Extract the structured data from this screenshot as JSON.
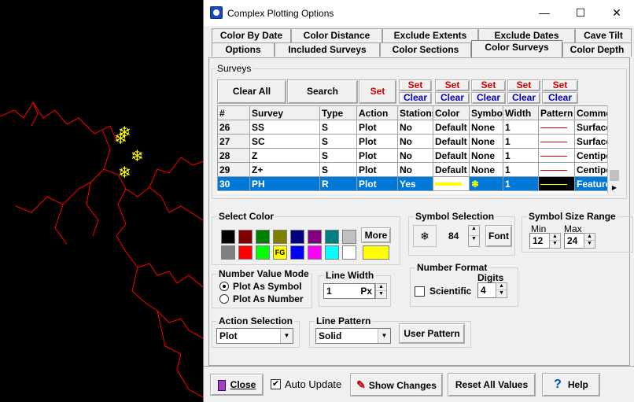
{
  "window": {
    "title": "Complex Plotting Options",
    "minimize": "—",
    "maximize": "☐",
    "close": "✕"
  },
  "tabs_row1": [
    "Color By Date",
    "Color Distance",
    "Exclude Extents",
    "Exclude Dates",
    "Cave Tilt"
  ],
  "tabs_row2": [
    "Options",
    "Included Surveys",
    "Color Sections",
    "Color Surveys",
    "Color Depth"
  ],
  "surveys": {
    "label": "Surveys",
    "clear_all": "Clear All",
    "search": "Search",
    "set": "Set",
    "set_label": "Set",
    "clear_label": "Clear",
    "columns": [
      "#",
      "Survey",
      "Type",
      "Action",
      "Stations",
      "Color",
      "Symbol",
      "Width",
      "Pattern",
      "Comment"
    ],
    "rows": [
      {
        "num": "26",
        "survey": "SS",
        "type": "S",
        "action": "Plot",
        "stations": "No",
        "color": "Default",
        "symbol": "None",
        "width": "1",
        "comment": "Surface"
      },
      {
        "num": "27",
        "survey": "SC",
        "type": "S",
        "action": "Plot",
        "stations": "No",
        "color": "Default",
        "symbol": "None",
        "width": "1",
        "comment": "Surface"
      },
      {
        "num": "28",
        "survey": "Z",
        "type": "S",
        "action": "Plot",
        "stations": "No",
        "color": "Default",
        "symbol": "None",
        "width": "1",
        "comment": "Centipede"
      },
      {
        "num": "29",
        "survey": "Z+",
        "type": "S",
        "action": "Plot",
        "stations": "No",
        "color": "Default",
        "symbol": "None",
        "width": "1",
        "comment": "Centipede"
      },
      {
        "num": "30",
        "survey": "PH",
        "type": "R",
        "action": "Plot",
        "stations": "Yes",
        "color": "",
        "symbol": "❄",
        "width": "1",
        "comment": "Feature"
      }
    ]
  },
  "select_color": {
    "label": "Select Color",
    "more": "More",
    "fg": "FG",
    "colors": [
      "#000000",
      "#800000",
      "#008000",
      "#808000",
      "#000080",
      "#800080",
      "#008080",
      "#c0c0c0",
      "#808080",
      "#ff0000",
      "#00ff00",
      "#ffff00",
      "#0000ff",
      "#ff00ff",
      "#00ffff",
      "#ffffff"
    ],
    "current": "#ffff00"
  },
  "symbol_selection": {
    "label": "Symbol Selection",
    "glyph": "❄",
    "value": "84",
    "font": "Font"
  },
  "symbol_size": {
    "label": "Symbol Size Range",
    "min_label": "Min",
    "max_label": "Max",
    "min": "12",
    "max": "24"
  },
  "number_value_mode": {
    "label": "Number Value Mode",
    "opt1": "Plot As Symbol",
    "opt2": "Plot As Number"
  },
  "line_width": {
    "label": "Line Width",
    "value": "1",
    "unit": "Px"
  },
  "number_format": {
    "label": "Number Format",
    "scientific": "Scientific",
    "digits_label": "Digits",
    "digits": "4"
  },
  "action_selection": {
    "label": "Action Selection",
    "value": "Plot"
  },
  "line_pattern": {
    "label": "Line Pattern",
    "value": "Solid",
    "user_pattern": "User Pattern"
  },
  "bottom": {
    "close": "Close",
    "auto_update": "Auto Update",
    "show_changes": "Show Changes",
    "reset": "Reset All Values",
    "help": "Help"
  }
}
